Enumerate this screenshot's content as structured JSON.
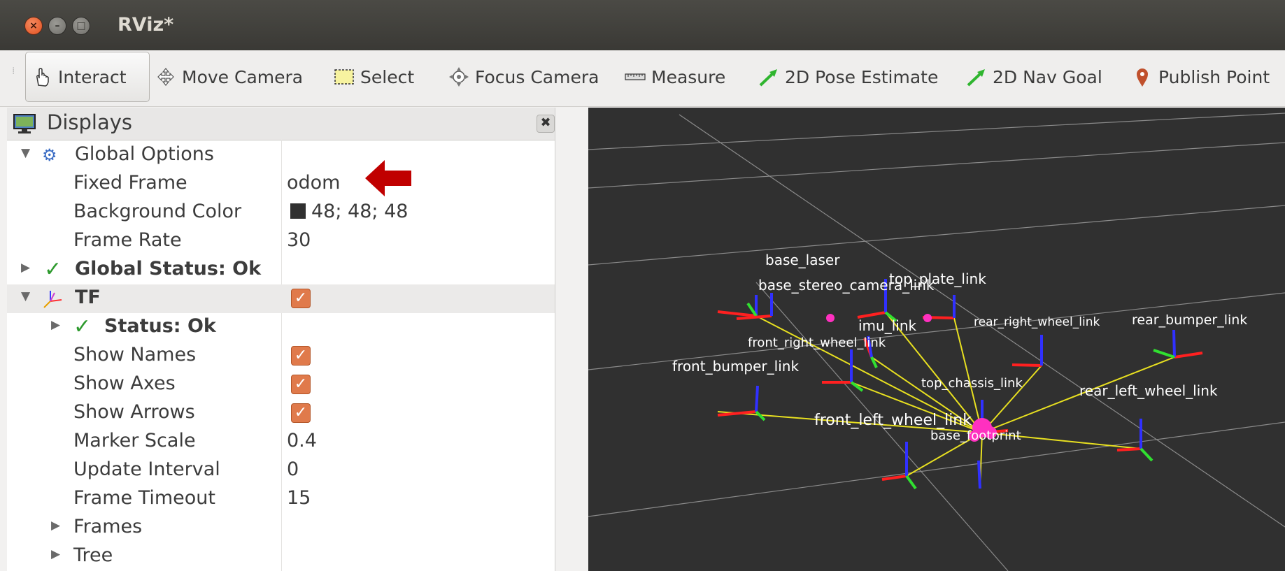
{
  "window": {
    "title": "RViz*"
  },
  "toolbar": {
    "tools": [
      {
        "label": "Interact",
        "icon": "hand-pointer-icon",
        "active": true
      },
      {
        "label": "Move Camera",
        "icon": "move-camera-icon",
        "active": false
      },
      {
        "label": "Select",
        "icon": "select-rect-icon",
        "active": false
      },
      {
        "label": "Focus Camera",
        "icon": "focus-camera-icon",
        "active": false
      },
      {
        "label": "Measure",
        "icon": "ruler-icon",
        "active": false
      },
      {
        "label": "2D Pose Estimate",
        "icon": "green-arrow-icon",
        "active": false
      },
      {
        "label": "2D Nav Goal",
        "icon": "green-arrow-icon",
        "active": false
      },
      {
        "label": "Publish Point",
        "icon": "map-pin-icon",
        "active": false
      }
    ]
  },
  "displays": {
    "title": "Displays",
    "global_options": "Global Options",
    "fixed_frame_label": "Fixed Frame",
    "fixed_frame_value": "odom",
    "background_color_label": "Background Color",
    "background_color_value": "48; 48; 48",
    "background_color_hex": "#303030",
    "frame_rate_label": "Frame Rate",
    "frame_rate_value": "30",
    "global_status": "Global Status: Ok",
    "tf_label": "TF",
    "tf_checked": true,
    "tf_status": "Status: Ok",
    "show_names_label": "Show Names",
    "show_names": true,
    "show_axes_label": "Show Axes",
    "show_axes": true,
    "show_arrows_label": "Show Arrows",
    "show_arrows": true,
    "marker_scale_label": "Marker Scale",
    "marker_scale_value": "0.4",
    "update_interval_label": "Update Interval",
    "update_interval_value": "0",
    "frame_timeout_label": "Frame Timeout",
    "frame_timeout_value": "15",
    "frames_label": "Frames",
    "tree_label": "Tree"
  },
  "viewport": {
    "background": "#303030",
    "frame_labels": [
      "base_laser",
      "base_stereo_camera_link",
      "top_plate_link",
      "imu_link",
      "rear_right_wheel_link",
      "rear_bumper_link",
      "front_right_wheel_link",
      "front_bumper_link",
      "top_chassis_link",
      "rear_left_wheel_link",
      "front_left_wheel_link",
      "base_footprint"
    ]
  },
  "annotation_color": "#c00000"
}
